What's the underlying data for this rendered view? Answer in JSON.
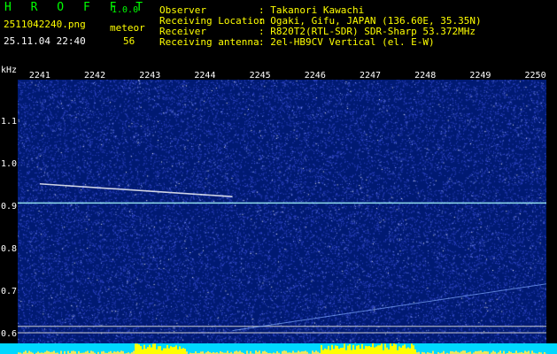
{
  "header": {
    "app_title": "H R O F F T",
    "version": "1.0.0",
    "filename": "2511042240.png",
    "datetime": "25.11.04 22:40",
    "meteor_label": "meteor",
    "meteor_count": "56",
    "observer_label": "Observer",
    "observer_value": ": Takanori Kawachi",
    "location_label": "Receiving Location",
    "location_value": ": Ogaki, Gifu, JAPAN (136.60E, 35.35N)",
    "receiver_label": "Receiver",
    "receiver_value": ": R820T2(RTL-SDR) SDR-Sharp 53.372MHz",
    "antenna_label": "Receiving antenna",
    "antenna_value": ": 2el-HB9CV Vertical (el. E-W)"
  },
  "chart_data": {
    "type": "heatmap",
    "ylabel": "kHz",
    "x_ticks": [
      "2241",
      "2242",
      "2243",
      "2244",
      "2245",
      "2246",
      "2247",
      "2248",
      "2249",
      "2250"
    ],
    "y_ticks": [
      "1.1",
      "1.0",
      "0.9",
      "0.8",
      "0.7",
      "0.6"
    ],
    "ylim": [
      0.58,
      1.2
    ],
    "xlim": [
      2240.6,
      2250.2
    ],
    "carrier_khz": 0.91,
    "meteor_trail": {
      "x_start": 2241.0,
      "x_end": 2244.5,
      "y_start": 0.955,
      "y_end": 0.925
    },
    "faint_trail": {
      "x_start": 2244.5,
      "x_end": 2250.2,
      "y_start": 0.61,
      "y_end": 0.72
    },
    "reference_lines_khz": [
      0.62,
      0.605
    ],
    "colors": {
      "background": "#001a73",
      "noise": "#3a4fd8",
      "carrier": "#aaffff",
      "trail": "#ffffff",
      "band": "#00d8ff",
      "burst": "#ffff00"
    }
  }
}
